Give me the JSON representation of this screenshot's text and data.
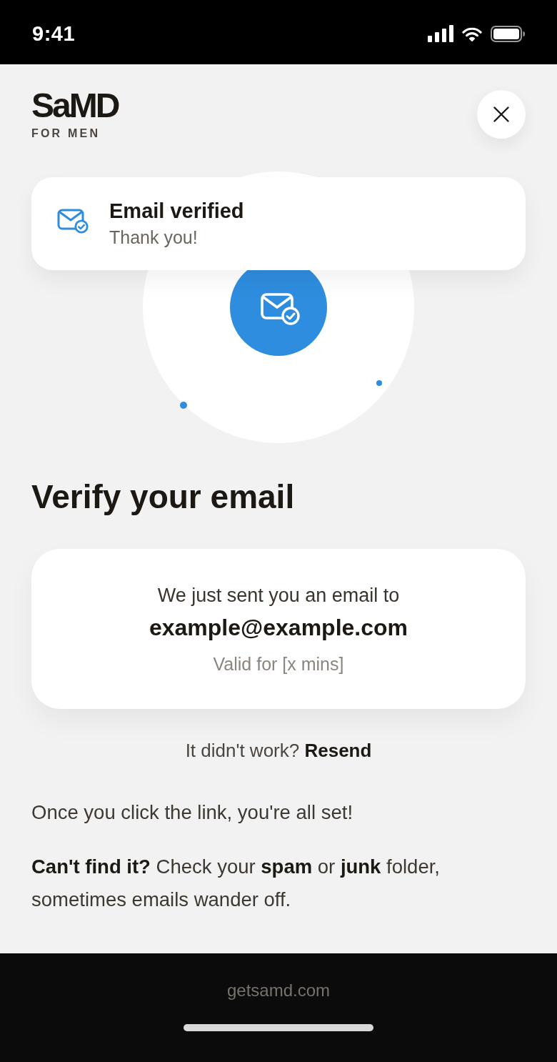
{
  "status_bar": {
    "time": "9:41"
  },
  "header": {
    "logo": "SaMD",
    "logo_subtitle": "FOR MEN"
  },
  "toast": {
    "title": "Email verified",
    "message": "Thank you!"
  },
  "page": {
    "title": "Verify your email"
  },
  "sent_card": {
    "intro": "We just sent you an email to",
    "email": "example@example.com",
    "validity": "Valid for [x mins]"
  },
  "resend": {
    "prompt": "It didn't work?",
    "link": "Resend"
  },
  "notes": [
    "Once you click the link, you're all set!",
    "**Can't find it?** Check your **spam** or **junk** folder, sometimes emails wander off."
  ],
  "footer": {
    "url": "getsamd.com"
  }
}
